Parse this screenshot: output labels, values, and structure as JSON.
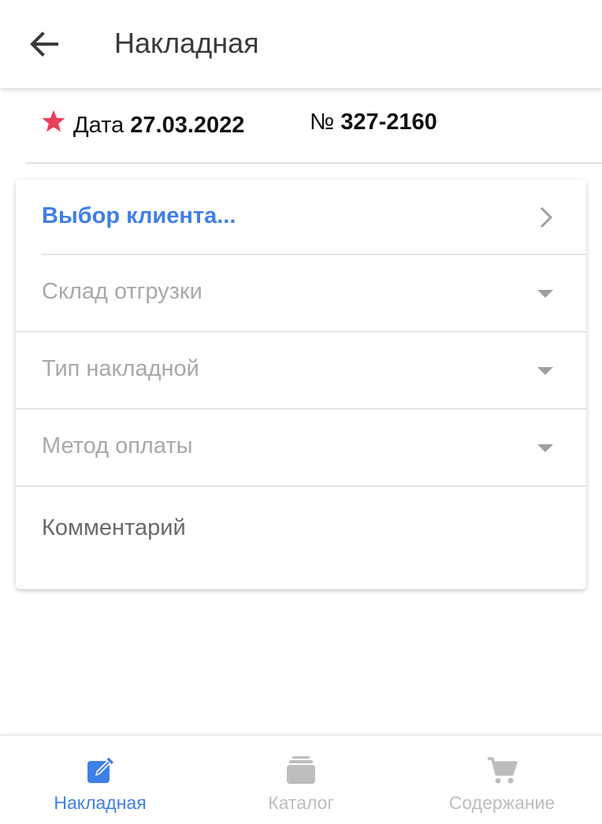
{
  "header": {
    "title": "Накладная",
    "back_icon": "arrow-left-icon"
  },
  "document": {
    "date_label": "Дата",
    "date_value": "27.03.2022",
    "number_label": "№",
    "number_value": "327-2160",
    "required_icon": "star-icon",
    "required_color": "#e8405a"
  },
  "form": {
    "client": {
      "label": "Выбор клиента...",
      "icon": "chevron-right-icon"
    },
    "warehouse": {
      "label": "Склад отгрузки",
      "icon": "caret-down-icon"
    },
    "invoice_type": {
      "label": "Тип накладной",
      "icon": "caret-down-icon"
    },
    "payment_method": {
      "label": "Метод оплаты",
      "icon": "caret-down-icon"
    },
    "comment": {
      "label": "Комментарий"
    }
  },
  "bottom_nav": {
    "items": [
      {
        "label": "Накладная",
        "icon": "edit-icon",
        "active": true
      },
      {
        "label": "Каталог",
        "icon": "layers-icon",
        "active": false
      },
      {
        "label": "Содержание",
        "icon": "cart-icon",
        "active": false
      }
    ]
  },
  "colors": {
    "accent": "#3f7fe8",
    "inactive": "#bdbdbd",
    "placeholder": "#a8a8a8"
  }
}
